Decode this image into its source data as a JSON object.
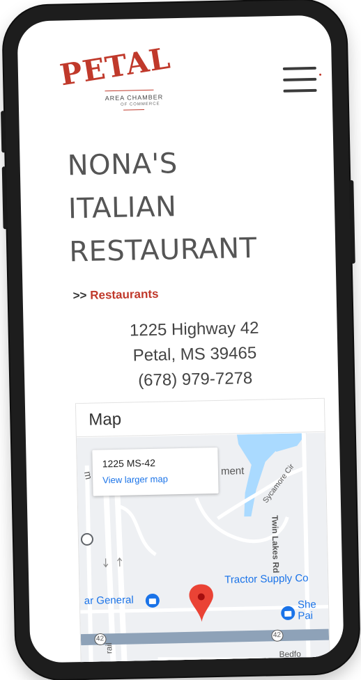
{
  "header": {
    "logo_word": "PETAL",
    "logo_line1": "AREA CHAMBER",
    "logo_line2": "OF COMMERCE",
    "menu_icon": "hamburger-menu-icon"
  },
  "listing": {
    "title_lines": [
      "NONA'S",
      "ITALIAN",
      "RESTAURANT"
    ],
    "breadcrumb_prefix": ">>",
    "category": "Restaurants",
    "address_line1": "1225 Highway 42",
    "address_line2": "Petal, MS 39465",
    "phone": "(678) 979-7278"
  },
  "map": {
    "heading": "Map",
    "info_title": "1225 MS-42",
    "info_link": "View larger map",
    "labels": {
      "dollar_general": "ar General",
      "tractor_supply": "Tractor Supply Co",
      "sherwin_1": "She",
      "sherwin_2": "Pai",
      "twin_lakes": "Twin Lakes Rd",
      "sycamore": "Sycamore Cir",
      "ment": "ment",
      "road_42": "42",
      "rail": "rail",
      "bedford": "Bedfo",
      "m_letter": "m"
    }
  },
  "colors": {
    "brand_red": "#c0392b",
    "link_blue": "#1a73e8",
    "water": "#aadaff",
    "highway": "#8ea2b8"
  }
}
